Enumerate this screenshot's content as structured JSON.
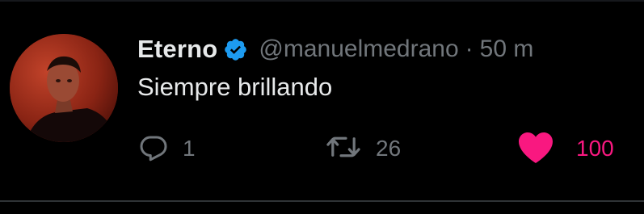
{
  "tweet": {
    "display_name": "Eterno",
    "handle": "@manuelmedrano",
    "separator": "·",
    "time": "50 m",
    "text": "Siempre brillando",
    "verified": true
  },
  "actions": {
    "reply": {
      "icon": "reply-icon",
      "count": "1"
    },
    "retweet": {
      "icon": "retweet-icon",
      "count": "26"
    },
    "like": {
      "icon": "heart-icon",
      "count": "100",
      "liked": true
    }
  },
  "colors": {
    "background": "#000000",
    "primary_text": "#e7e9ea",
    "secondary_text": "#71767b",
    "verified_blue": "#1d9bf0",
    "like_pink": "#f91880",
    "divider": "#2f3336"
  }
}
